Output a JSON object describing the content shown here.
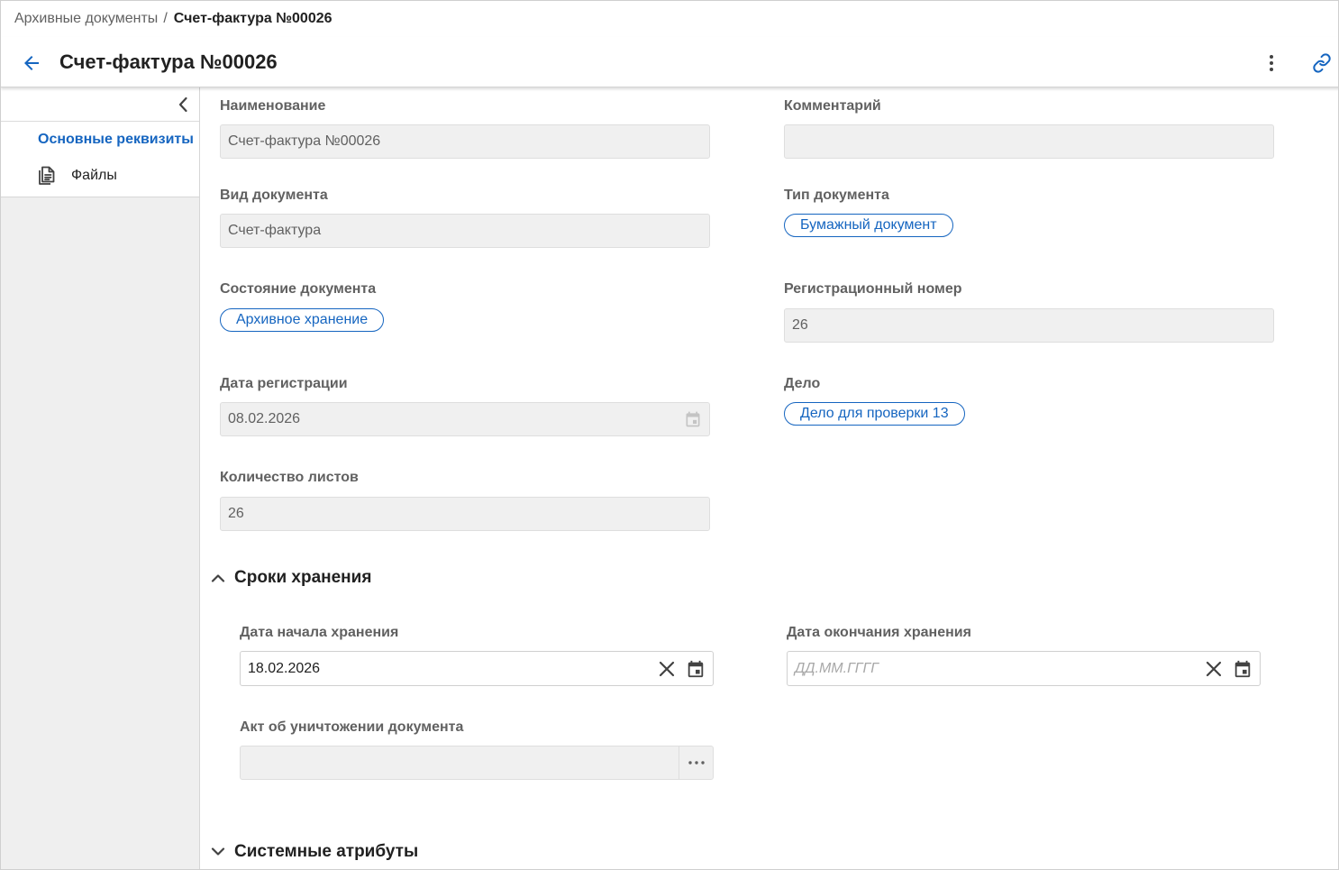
{
  "breadcrumb": {
    "root": "Архивные документы",
    "separator": "/",
    "current": "Счет-фактура №00026"
  },
  "header": {
    "title": "Счет-фактура №00026",
    "back_icon": "arrow-left-icon",
    "more_icon": "dots-vertical-icon",
    "link_icon": "link-icon"
  },
  "sidebar": {
    "collapse_icon": "chevron-left-icon",
    "items": [
      {
        "label": "Основные реквизиты",
        "active": true
      },
      {
        "label": "Файлы",
        "icon": "document-file-icon"
      }
    ]
  },
  "form": {
    "name": {
      "label": "Наименование",
      "value": "Счет-фактура №00026"
    },
    "comment": {
      "label": "Комментарий",
      "value": ""
    },
    "doc_kind": {
      "label": "Вид документа",
      "value": "Счет-фактура"
    },
    "doc_type": {
      "label": "Тип документа",
      "value": "Бумажный документ"
    },
    "doc_state": {
      "label": "Состояние документа",
      "value": "Архивное хранение"
    },
    "reg_number": {
      "label": "Регистрационный номер",
      "value": "26"
    },
    "reg_date": {
      "label": "Дата регистрации",
      "value": "08.02.2026"
    },
    "case": {
      "label": "Дело",
      "value": "Дело для проверки 13"
    },
    "sheets": {
      "label": "Количество листов",
      "value": "26"
    }
  },
  "storage": {
    "title": "Сроки хранения",
    "expanded": true,
    "start_date": {
      "label": "Дата начала хранения",
      "value": "18.02.2026"
    },
    "end_date": {
      "label": "Дата окончания хранения",
      "value": "",
      "placeholder": "ДД.ММ.ГГГГ"
    },
    "destruction_act": {
      "label": "Акт об уничтожении документа",
      "value": ""
    }
  },
  "system": {
    "title": "Системные атрибуты",
    "expanded": false
  },
  "colors": {
    "accent": "#1565c0",
    "label": "#616161",
    "field_bg": "#f0f0f0",
    "sidebar_bg": "#efefef"
  }
}
